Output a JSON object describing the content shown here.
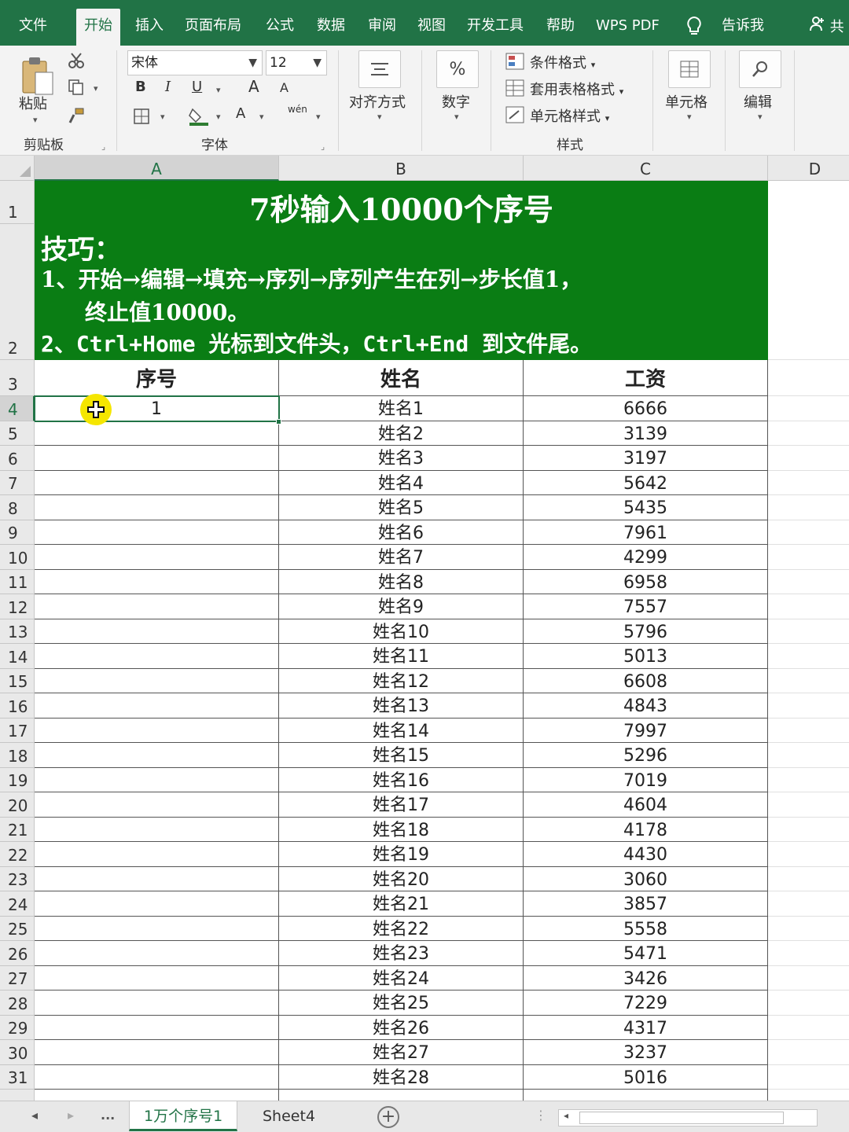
{
  "ribbon_tabs": [
    "文件",
    "开始",
    "插入",
    "页面布局",
    "公式",
    "数据",
    "审阅",
    "视图",
    "开发工具",
    "帮助",
    "WPS PDF"
  ],
  "active_tab": "开始",
  "tell_me": "告诉我",
  "share": "共",
  "clipboard": {
    "paste": "粘贴",
    "label": "剪贴板"
  },
  "font": {
    "name": "宋体",
    "size": "12",
    "label": "字体",
    "bold": "B",
    "italic": "I",
    "underline": "U",
    "grow": "A",
    "shrink": "A",
    "color": "A",
    "phonetic": "wén"
  },
  "alignment": {
    "label": "对齐方式"
  },
  "number": {
    "label": "数字",
    "symbol": "%"
  },
  "styles": {
    "conditional": "条件格式",
    "table": "套用表格格式",
    "cell": "单元格样式",
    "label": "样式"
  },
  "cells": {
    "label": "单元格"
  },
  "editing": {
    "label": "编辑"
  },
  "columns": [
    "A",
    "B",
    "C",
    "D"
  ],
  "selected_column": "A",
  "banner": {
    "title": "7秒输入10000个序号",
    "heading": "技巧：",
    "line1": "1、开始→编辑→填充→序列→序列产生在列→步长值1，",
    "line1_cont": "终止值10000。",
    "line2": "2、Ctrl+Home 光标到文件头，Ctrl+End 到文件尾。"
  },
  "table_headers": [
    "序号",
    "姓名",
    "工资"
  ],
  "first_row_index": 4,
  "selected_row": 4,
  "rows": [
    {
      "seq": "1",
      "name": "姓名1",
      "salary": "6666"
    },
    {
      "seq": "",
      "name": "姓名2",
      "salary": "3139"
    },
    {
      "seq": "",
      "name": "姓名3",
      "salary": "3197"
    },
    {
      "seq": "",
      "name": "姓名4",
      "salary": "5642"
    },
    {
      "seq": "",
      "name": "姓名5",
      "salary": "5435"
    },
    {
      "seq": "",
      "name": "姓名6",
      "salary": "7961"
    },
    {
      "seq": "",
      "name": "姓名7",
      "salary": "4299"
    },
    {
      "seq": "",
      "name": "姓名8",
      "salary": "6958"
    },
    {
      "seq": "",
      "name": "姓名9",
      "salary": "7557"
    },
    {
      "seq": "",
      "name": "姓名10",
      "salary": "5796"
    },
    {
      "seq": "",
      "name": "姓名11",
      "salary": "5013"
    },
    {
      "seq": "",
      "name": "姓名12",
      "salary": "6608"
    },
    {
      "seq": "",
      "name": "姓名13",
      "salary": "4843"
    },
    {
      "seq": "",
      "name": "姓名14",
      "salary": "7997"
    },
    {
      "seq": "",
      "name": "姓名15",
      "salary": "5296"
    },
    {
      "seq": "",
      "name": "姓名16",
      "salary": "7019"
    },
    {
      "seq": "",
      "name": "姓名17",
      "salary": "4604"
    },
    {
      "seq": "",
      "name": "姓名18",
      "salary": "4178"
    },
    {
      "seq": "",
      "name": "姓名19",
      "salary": "4430"
    },
    {
      "seq": "",
      "name": "姓名20",
      "salary": "3060"
    },
    {
      "seq": "",
      "name": "姓名21",
      "salary": "3857"
    },
    {
      "seq": "",
      "name": "姓名22",
      "salary": "5558"
    },
    {
      "seq": "",
      "name": "姓名23",
      "salary": "5471"
    },
    {
      "seq": "",
      "name": "姓名24",
      "salary": "3426"
    },
    {
      "seq": "",
      "name": "姓名25",
      "salary": "7229"
    },
    {
      "seq": "",
      "name": "姓名26",
      "salary": "4317"
    },
    {
      "seq": "",
      "name": "姓名27",
      "salary": "3237"
    },
    {
      "seq": "",
      "name": "姓名28",
      "salary": "5016"
    }
  ],
  "sheet_tabs": [
    "1万个序号1",
    "Sheet4"
  ],
  "active_sheet": "1万个序号1",
  "more_sheets": "...",
  "colors": {
    "excel_green": "#217346",
    "banner_green": "#0a7d14",
    "cursor_yellow": "#f5e600"
  }
}
